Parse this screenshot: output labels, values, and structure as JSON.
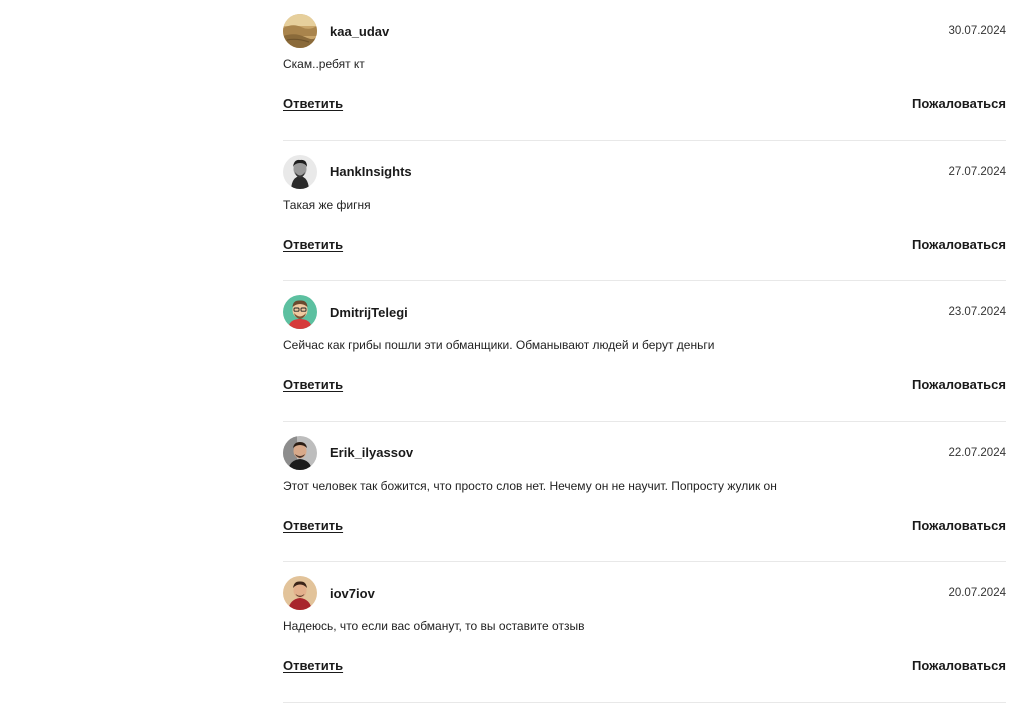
{
  "comments": [
    {
      "username": "kaa_udav",
      "date": "30.07.2024",
      "text": "Скам..ребят кт",
      "reply_label": "Ответить",
      "report_label": "Пожаловаться",
      "avatar": "desert-landscape-avatar"
    },
    {
      "username": "HankInsights",
      "date": "27.07.2024",
      "text": "Такая же фигня",
      "reply_label": "Ответить",
      "report_label": "Пожаловаться",
      "avatar": "bw-portrait-avatar"
    },
    {
      "username": "DmitrijTelegi",
      "date": "23.07.2024",
      "text": "Сейчас как грибы пошли эти обманщики. Обманывают людей и берут деньги",
      "reply_label": "Ответить",
      "report_label": "Пожаловаться",
      "avatar": "cartoon-avatar"
    },
    {
      "username": "Erik_ilyassov",
      "date": "22.07.2024",
      "text": "Этот человек так божится, что просто слов нет. Нечему он не научит. Попросту жулик он",
      "reply_label": "Ответить",
      "report_label": "Пожаловаться",
      "avatar": "man-portrait-avatar"
    },
    {
      "username": "iov7iov",
      "date": "20.07.2024",
      "text": "Надеюсь, что если вас обманут, то вы оставите отзыв",
      "reply_label": "Ответить",
      "report_label": "Пожаловаться",
      "avatar": "red-shirt-portrait-avatar"
    }
  ]
}
